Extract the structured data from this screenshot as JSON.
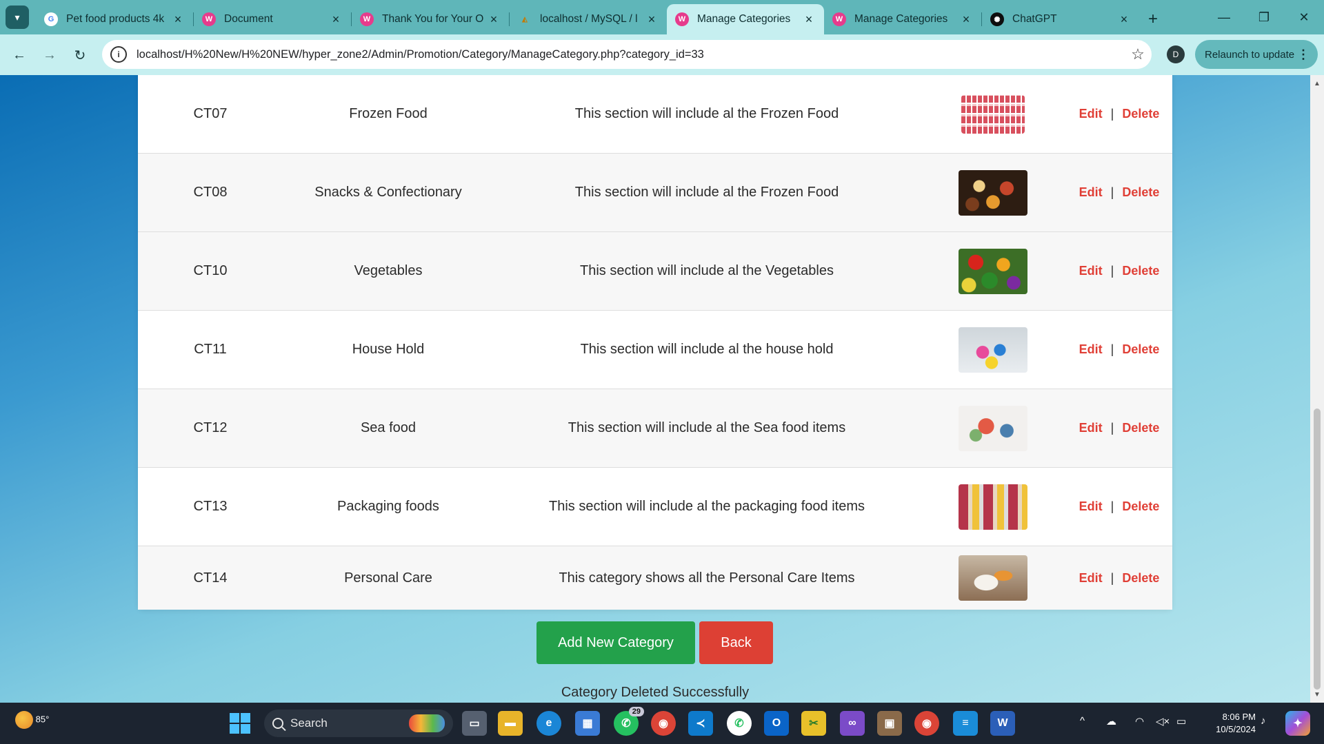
{
  "browser": {
    "tabs": [
      {
        "label": "Pet food products 4k",
        "icon": "google-icon",
        "active": false
      },
      {
        "label": "Document",
        "icon": "site-icon",
        "active": false
      },
      {
        "label": "Thank You for Your O",
        "icon": "site-icon",
        "active": false
      },
      {
        "label": "localhost / MySQL / l",
        "icon": "phpmyadmin-icon",
        "active": false
      },
      {
        "label": "Manage Categories",
        "icon": "site-icon",
        "active": true
      },
      {
        "label": "Manage Categories",
        "icon": "site-icon",
        "active": false
      },
      {
        "label": "ChatGPT",
        "icon": "chatgpt-icon",
        "active": false
      }
    ],
    "url": "localhost/H%20New/H%20NEW/hyper_zone2/Admin/Promotion/Category/ManageCategory.php?category_id=33",
    "profile_initial": "D",
    "relaunch_label": "Relaunch to update"
  },
  "categories": {
    "rows": [
      {
        "id": "CT07",
        "name": "Frozen Food",
        "description": "This section will include al the Frozen Food",
        "image": "frozen-food-thumbnail"
      },
      {
        "id": "CT08",
        "name": "Snacks & Confectionary",
        "description": "This section will include al the Frozen Food",
        "image": "snacks-thumbnail"
      },
      {
        "id": "CT10",
        "name": "Vegetables",
        "description": "This section will include al the Vegetables",
        "image": "vegetables-thumbnail"
      },
      {
        "id": "CT11",
        "name": "House Hold",
        "description": "This section will include al the house hold",
        "image": "household-thumbnail"
      },
      {
        "id": "CT12",
        "name": "Sea food",
        "description": "This section will include al the Sea food items",
        "image": "seafood-thumbnail"
      },
      {
        "id": "CT13",
        "name": "Packaging foods",
        "description": "This section will include al the packaging food items",
        "image": "packaging-thumbnail"
      },
      {
        "id": "CT14",
        "name": "Personal Care",
        "description": "This category shows all the Personal Care Items",
        "image": "personal-care-thumbnail"
      }
    ],
    "edit_label": "Edit",
    "delete_label": "Delete",
    "separator": "|"
  },
  "actions": {
    "add_label": "Add New Category",
    "back_label": "Back"
  },
  "status_message": "Category Deleted Successfully",
  "taskbar": {
    "weather_temp": "85°",
    "search_label": "Search",
    "whatsapp_badge": "29",
    "time": "8:06 PM",
    "date": "10/5/2024"
  },
  "colors": {
    "tab_strip": "#5fb6b9",
    "toolbar": "#c6eff0",
    "add_button": "#23a14b",
    "back_button": "#dd4034",
    "action_link": "#e03f36"
  }
}
